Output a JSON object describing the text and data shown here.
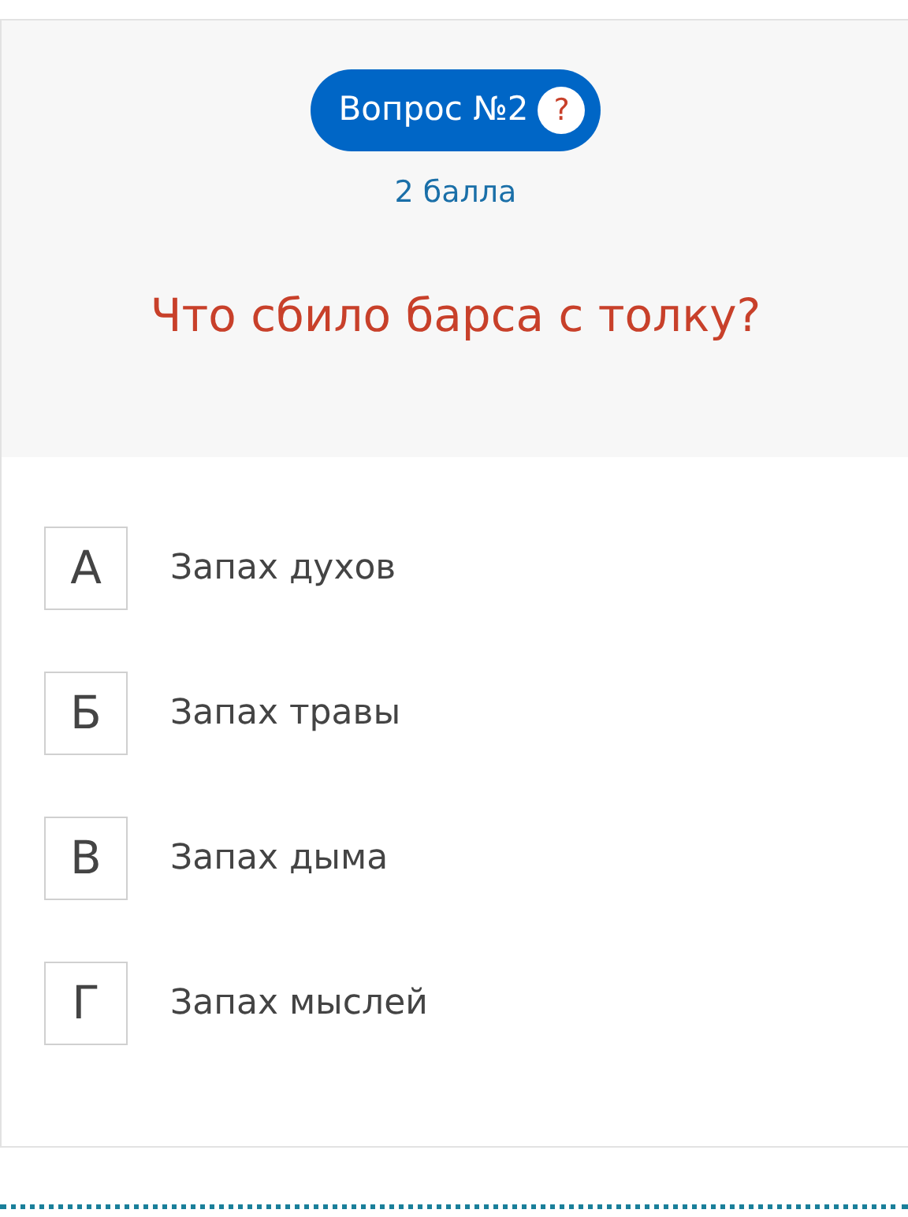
{
  "question": {
    "badge": "Вопрос №2",
    "help": "?",
    "points": "2 балла",
    "text": "Что сбило барса с толку?"
  },
  "answers": [
    {
      "letter": "А",
      "text": "Запах духов"
    },
    {
      "letter": "Б",
      "text": "Запах травы"
    },
    {
      "letter": "В",
      "text": "Запах дыма"
    },
    {
      "letter": "Г",
      "text": "Запах мыслей"
    }
  ]
}
